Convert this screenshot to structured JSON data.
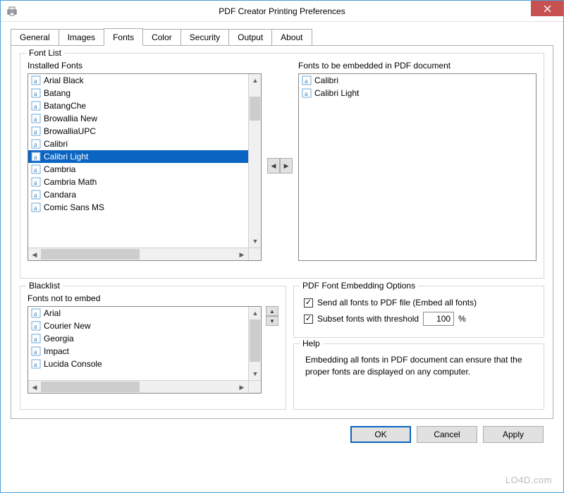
{
  "window": {
    "title": "PDF Creator Printing Preferences"
  },
  "tabs": [
    {
      "label": "General",
      "active": false
    },
    {
      "label": "Images",
      "active": false
    },
    {
      "label": "Fonts",
      "active": true
    },
    {
      "label": "Color",
      "active": false
    },
    {
      "label": "Security",
      "active": false
    },
    {
      "label": "Output",
      "active": false
    },
    {
      "label": "About",
      "active": false
    }
  ],
  "fontList": {
    "legend": "Font List",
    "installedLabel": "Installed Fonts",
    "embeddedLabel": "Fonts to be embedded in PDF document",
    "installed": [
      {
        "name": "Arial Black",
        "selected": false
      },
      {
        "name": "Batang",
        "selected": false
      },
      {
        "name": "BatangChe",
        "selected": false
      },
      {
        "name": "Browallia New",
        "selected": false
      },
      {
        "name": "BrowalliaUPC",
        "selected": false
      },
      {
        "name": "Calibri",
        "selected": false
      },
      {
        "name": "Calibri Light",
        "selected": true
      },
      {
        "name": "Cambria",
        "selected": false
      },
      {
        "name": "Cambria Math",
        "selected": false
      },
      {
        "name": "Candara",
        "selected": false
      },
      {
        "name": "Comic Sans MS",
        "selected": false
      }
    ],
    "embedded": [
      {
        "name": "Calibri"
      },
      {
        "name": "Calibri Light"
      }
    ]
  },
  "blacklist": {
    "legend": "Blacklist",
    "label": "Fonts not to embed",
    "items": [
      {
        "name": "Arial"
      },
      {
        "name": "Courier New"
      },
      {
        "name": "Georgia"
      },
      {
        "name": "Impact"
      },
      {
        "name": "Lucida Console"
      }
    ]
  },
  "embedOptions": {
    "legend": "PDF Font Embedding Options",
    "sendAll": {
      "label": "Send all fonts to PDF file (Embed all fonts)",
      "checked": true
    },
    "subset": {
      "label": "Subset fonts with threshold",
      "checked": true,
      "value": "100",
      "unit": "%"
    }
  },
  "help": {
    "legend": "Help",
    "text": "Embedding all fonts in PDF document can ensure that the proper fonts are displayed on any computer."
  },
  "buttons": {
    "ok": "OK",
    "cancel": "Cancel",
    "apply": "Apply"
  },
  "watermark": "LO4D.com"
}
